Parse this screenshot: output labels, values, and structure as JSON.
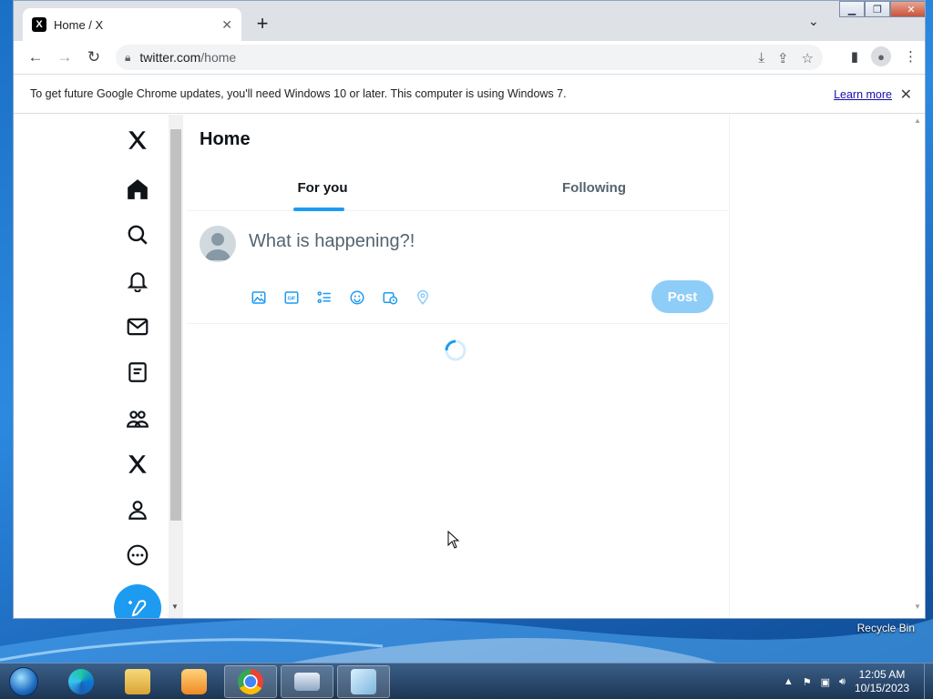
{
  "browser": {
    "tab_title": "Home / X",
    "tab_favicon": "X",
    "url_host": "twitter.com",
    "url_path": "/home",
    "icons": {
      "back": "arrow-left-icon",
      "forward": "arrow-right-icon",
      "reload": "reload-icon",
      "lock": "lock-icon",
      "install": "install-app-icon",
      "share": "share-icon",
      "bookmark": "star-icon",
      "side_panel": "side-panel-icon",
      "profile": "profile-icon",
      "menu": "kebab-menu-icon"
    }
  },
  "infobar": {
    "message": "To get future Google Chrome updates, you'll need Windows 10 or later. This computer is using Windows 7.",
    "learn_more": "Learn more"
  },
  "x": {
    "sidebar_icons": [
      "x-logo-icon",
      "home-icon",
      "search-icon",
      "bell-icon",
      "mail-icon",
      "lists-icon",
      "communities-icon",
      "x-premium-icon",
      "profile-icon",
      "more-circle-icon",
      "compose-icon"
    ],
    "page_title": "Home",
    "tabs": [
      {
        "label": "For you",
        "active": true
      },
      {
        "label": "Following",
        "active": false
      }
    ],
    "composer": {
      "placeholder": "What is happening?!",
      "post_label": "Post",
      "tool_icons": [
        "image-icon",
        "gif-icon",
        "poll-icon",
        "emoji-icon",
        "schedule-icon",
        "location-icon"
      ]
    },
    "accent": "#1d9bf0"
  },
  "desktop": {
    "recycle_bin_label": "Recycle Bin"
  },
  "taskbar": {
    "time": "12:05 AM",
    "date": "10/15/2023",
    "apps": [
      "edge-icon",
      "explorer-icon",
      "media-player-icon",
      "chrome-icon",
      "keyboard-icon",
      "notepad-icon"
    ]
  }
}
